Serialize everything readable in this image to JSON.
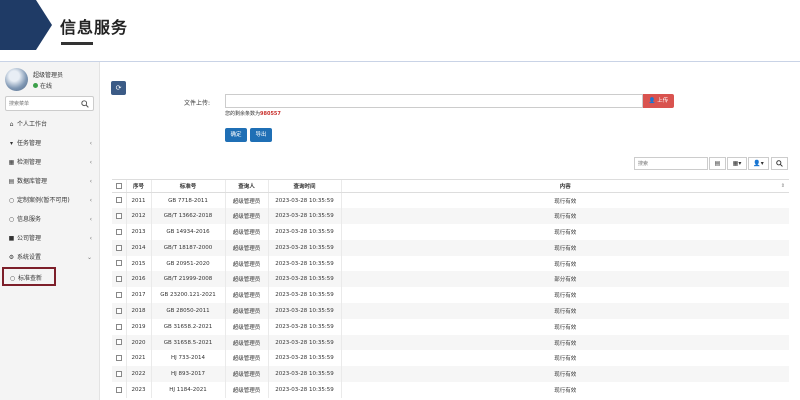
{
  "header": {
    "title": "信息服务"
  },
  "sidebar": {
    "user": {
      "name": "超级管理员",
      "status": "在线"
    },
    "search_placeholder": "搜索菜单",
    "items": [
      {
        "label": "个人工作台",
        "icon": "home-icon",
        "has_arrow": false
      },
      {
        "label": "任务管理",
        "icon": "filter-icon",
        "has_arrow": true
      },
      {
        "label": "检测管理",
        "icon": "keyboard-icon",
        "has_arrow": true
      },
      {
        "label": "数据库管理",
        "icon": "database-icon",
        "has_arrow": true
      },
      {
        "label": "定制案例(暂不可用)",
        "icon": "circle-icon",
        "has_arrow": true
      },
      {
        "label": "信息服务",
        "icon": "circle-icon",
        "has_arrow": true
      },
      {
        "label": "公司管理",
        "icon": "square-icon",
        "has_arrow": true
      },
      {
        "label": "系统设置",
        "icon": "gears-icon",
        "has_arrow": true
      },
      {
        "label": "标准查新",
        "icon": "circle-icon",
        "has_arrow": false
      }
    ]
  },
  "main": {
    "upload_label": "文件上传:",
    "upload_button": "上传",
    "remaining_prefix": "您的剩余条数为",
    "remaining_count": "980557",
    "confirm_button": "确定",
    "export_button": "导出",
    "search_placeholder": "搜索"
  },
  "table": {
    "columns": [
      "序号",
      "标准号",
      "查询人",
      "查询时间",
      "内容"
    ],
    "rows": [
      [
        "2011",
        "GB 7718-2011",
        "超级管理员",
        "2023-03-28 10:35:59",
        "现行有效"
      ],
      [
        "2012",
        "GB/T 13662-2018",
        "超级管理员",
        "2023-03-28 10:35:59",
        "现行有效"
      ],
      [
        "2013",
        "GB 14934-2016",
        "超级管理员",
        "2023-03-28 10:35:59",
        "现行有效"
      ],
      [
        "2014",
        "GB/T 18187-2000",
        "超级管理员",
        "2023-03-28 10:35:59",
        "现行有效"
      ],
      [
        "2015",
        "GB 20951-2020",
        "超级管理员",
        "2023-03-28 10:35:59",
        "现行有效"
      ],
      [
        "2016",
        "GB/T 21999-2008",
        "超级管理员",
        "2023-03-28 10:35:59",
        "部分有效"
      ],
      [
        "2017",
        "GB 23200.121-2021",
        "超级管理员",
        "2023-03-28 10:35:59",
        "现行有效"
      ],
      [
        "2018",
        "GB 28050-2011",
        "超级管理员",
        "2023-03-28 10:35:59",
        "现行有效"
      ],
      [
        "2019",
        "GB 31658.2-2021",
        "超级管理员",
        "2023-03-28 10:35:59",
        "现行有效"
      ],
      [
        "2020",
        "GB 31658.5-2021",
        "超级管理员",
        "2023-03-28 10:35:59",
        "现行有效"
      ],
      [
        "2021",
        "HJ 733-2014",
        "超级管理员",
        "2023-03-28 10:35:59",
        "现行有效"
      ],
      [
        "2022",
        "HJ 893-2017",
        "超级管理员",
        "2023-03-28 10:35:59",
        "现行有效"
      ],
      [
        "2023",
        "HJ 1184-2021",
        "超级管理员",
        "2023-03-28 10:35:59",
        "现行有效"
      ]
    ]
  },
  "colors": {
    "brand": "#1f3b66",
    "highlight_box": "#7d1f2a",
    "upload_button": "#d9534f",
    "primary_button": "#1f6fb5",
    "refresh_button": "#3b5b86"
  }
}
